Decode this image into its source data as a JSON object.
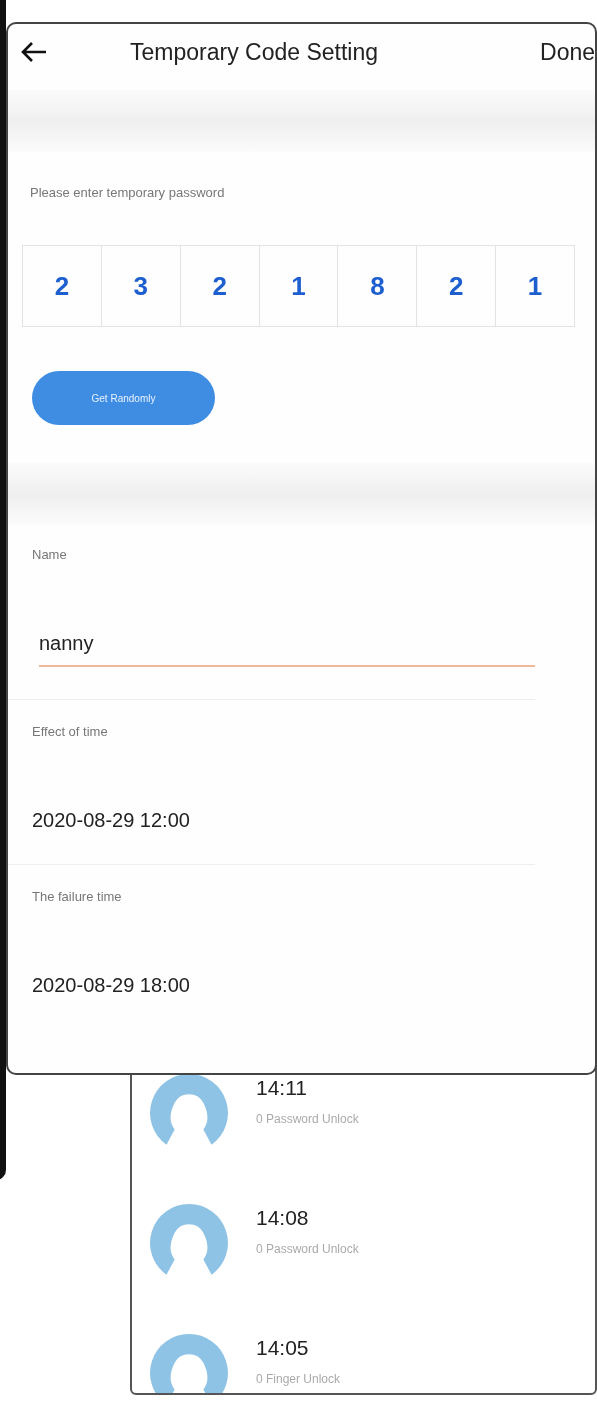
{
  "header": {
    "title": "Temporary Code Setting",
    "done": "Done"
  },
  "password_label": "Please enter temporary password",
  "code_digits": [
    "2",
    "3",
    "2",
    "1",
    "8",
    "2",
    "1"
  ],
  "random_button": "Get Randomly",
  "fields": [
    {
      "kind": "input",
      "label": "Name",
      "value": "nanny"
    },
    {
      "kind": "time",
      "label": "Effect of time",
      "value": "2020-08-29 12:00"
    },
    {
      "kind": "time",
      "label": "The failure time",
      "value": "2020-08-29 18:00"
    }
  ],
  "unlock_records": [
    {
      "time": "14:11",
      "event": "0 Password Unlock"
    },
    {
      "time": "14:08",
      "event": "0 Password Unlock"
    },
    {
      "time": "14:05",
      "event": "0 Finger Unlock"
    }
  ]
}
